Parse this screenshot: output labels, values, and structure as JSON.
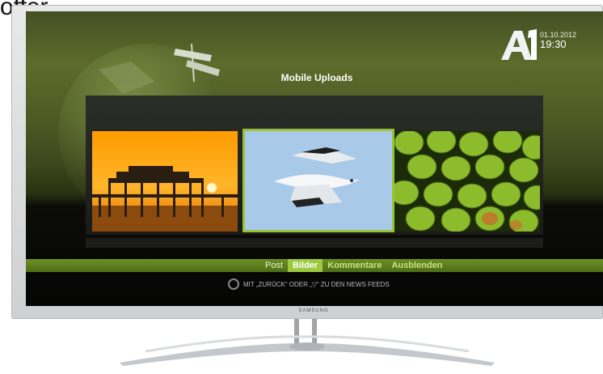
{
  "caption": "offer",
  "header": {
    "date": "01.10.2012",
    "time": "19:30",
    "title": "Mobile Uploads",
    "logo_name": "A1"
  },
  "gallery": {
    "images": [
      {
        "name": "pier-sunset-photo",
        "selected": false
      },
      {
        "name": "seagull-photo",
        "selected": true
      },
      {
        "name": "green-fruit-photo",
        "selected": false
      }
    ]
  },
  "menu": {
    "items": [
      "Post",
      "Bilder",
      "Kommentare",
      "Ausblenden"
    ],
    "active": "Bilder"
  },
  "hint": "MIT „ZURÜCK“ ODER „▽“ ZU DEN NEWS FEEDS",
  "tv_brand": "SAMSUNG",
  "colors": {
    "accent": "#9cc93d",
    "bar": "#5b7c1c"
  }
}
